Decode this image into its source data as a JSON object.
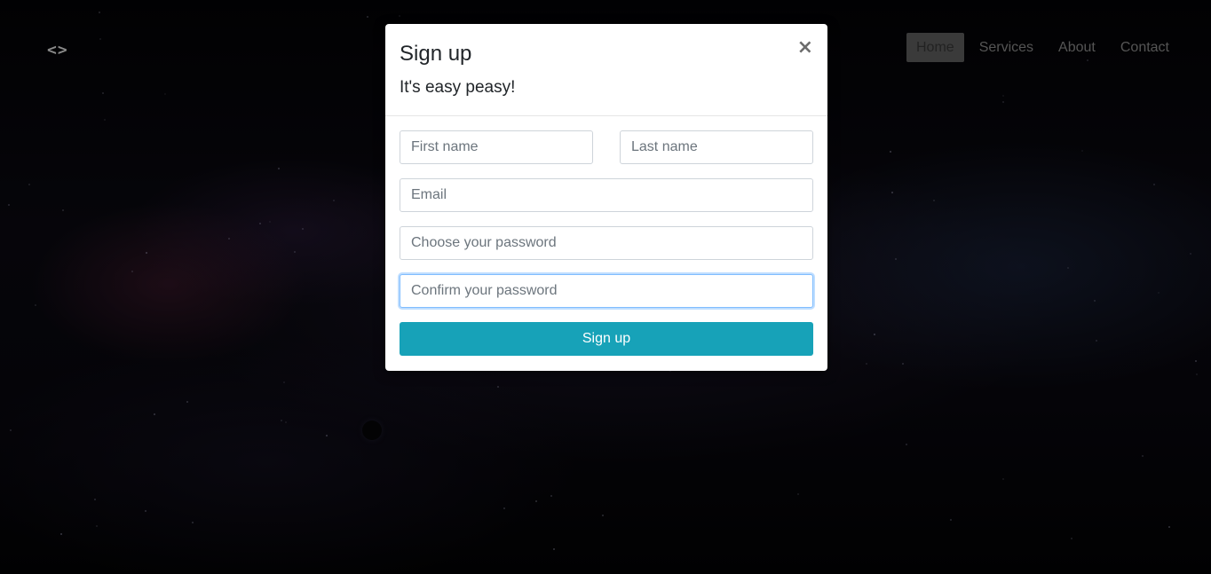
{
  "logo": {
    "text": "<>"
  },
  "nav": {
    "items": [
      {
        "label": "Home",
        "active": true
      },
      {
        "label": "Services",
        "active": false
      },
      {
        "label": "About",
        "active": false
      },
      {
        "label": "Contact",
        "active": false
      }
    ]
  },
  "modal": {
    "title": "Sign up",
    "subtitle": "It's easy peasy!",
    "close_label": "×",
    "fields": {
      "first_name": {
        "placeholder": "First name",
        "value": ""
      },
      "last_name": {
        "placeholder": "Last name",
        "value": ""
      },
      "email": {
        "placeholder": "Email",
        "value": ""
      },
      "password": {
        "placeholder": "Choose your password",
        "value": ""
      },
      "confirm_password": {
        "placeholder": "Confirm your password",
        "value": ""
      }
    },
    "submit_label": "Sign up"
  },
  "colors": {
    "accent": "#17a2b8",
    "focus_border": "#80bdff",
    "nav_active_bg": "#3a3a3a"
  }
}
